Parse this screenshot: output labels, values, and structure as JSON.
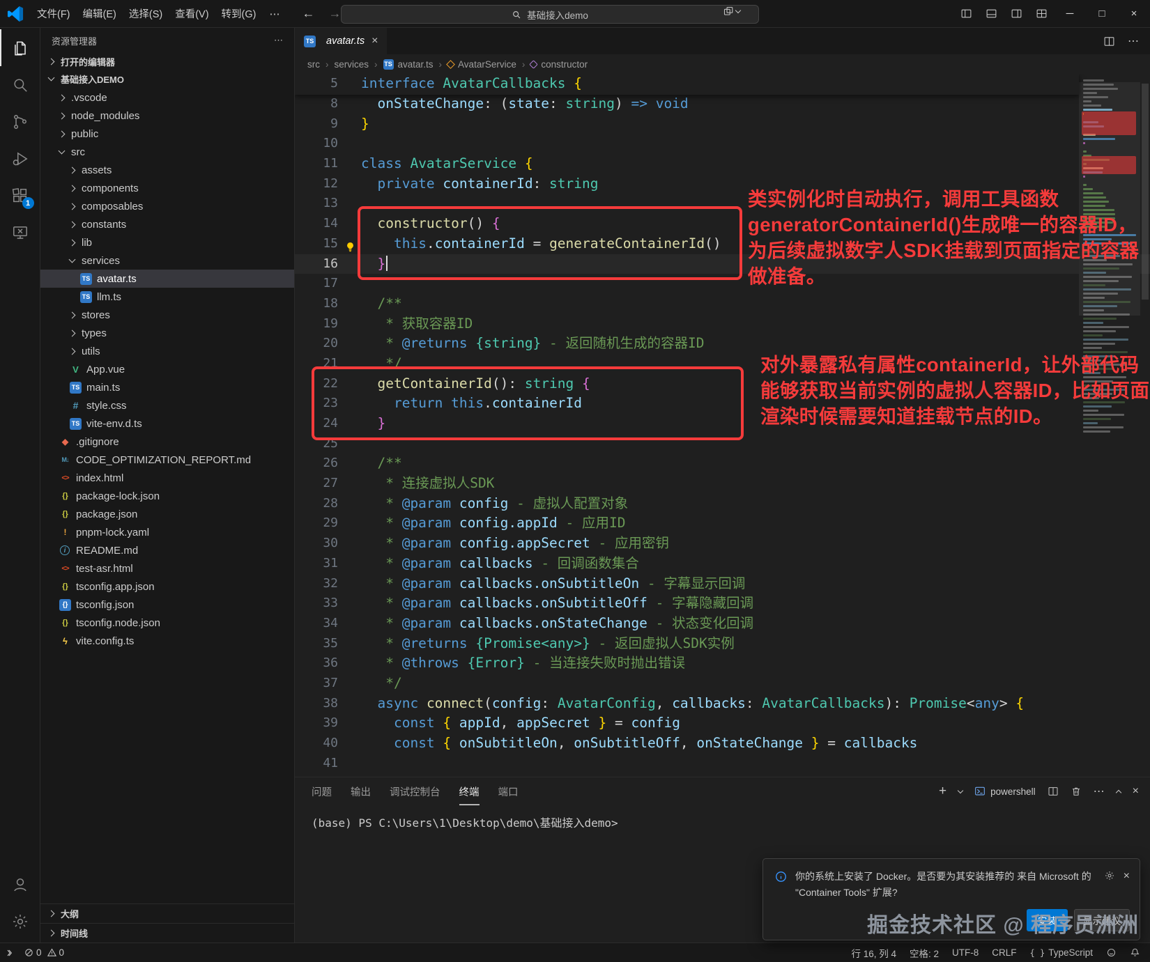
{
  "colors": {
    "accent": "#0078d4",
    "red": "#f53b3b",
    "kw": "#569cd6",
    "type": "#4ec9b0",
    "fn": "#dcdcaa",
    "var": "#9cdcfe",
    "cm": "#6a9955",
    "tag": "#569cd6",
    "doctype": "#4ec9b0",
    "pl": "#d4d4d4",
    "br": "#ffd700",
    "brp": "#da70d6"
  },
  "glyphs": {
    "back": "←",
    "forward": "→",
    "more": "⋯",
    "window_minimize": "─",
    "window_maximize": "□",
    "window_close": "×",
    "tab_close": "×",
    "panel_plus": "+",
    "panel_more": "⋯",
    "panel_close": "×",
    "toast_close": "×",
    "breadcrumb_sep": "›",
    "sidebar_more": "⋯",
    "tab_actions_more": "⋯"
  },
  "icon_glyphs": {
    "ts": "TS",
    "vue": "V",
    "css": "#",
    "git": "◆",
    "md": "M↓",
    "info": "i",
    "html": "<>",
    "json": "{}",
    "yaml": "!",
    "tsconfig": "{}",
    "vite": "ϟ"
  },
  "title_bar": {
    "menus": [
      "文件(F)",
      "编辑(E)",
      "选择(S)",
      "查看(V)",
      "转到(G)"
    ],
    "command_center": "基础接入demo"
  },
  "activity_bar": {
    "extensions_badge": "1"
  },
  "sidebar": {
    "header": "资源管理器",
    "open_editors": "打开的编辑器",
    "project": "基础接入DEMO",
    "outline": "大纲",
    "timeline": "时间线",
    "tree": [
      {
        "label": ".vscode",
        "lvl": 1,
        "folder": true
      },
      {
        "label": "node_modules",
        "lvl": 1,
        "folder": true
      },
      {
        "label": "public",
        "lvl": 1,
        "folder": true
      },
      {
        "label": "src",
        "lvl": 1,
        "folder": true,
        "expanded": true
      },
      {
        "label": "assets",
        "lvl": 2,
        "folder": true
      },
      {
        "label": "components",
        "lvl": 2,
        "folder": true
      },
      {
        "label": "composables",
        "lvl": 2,
        "folder": true
      },
      {
        "label": "constants",
        "lvl": 2,
        "folder": true
      },
      {
        "label": "lib",
        "lvl": 2,
        "folder": true
      },
      {
        "label": "services",
        "lvl": 2,
        "folder": true,
        "expanded": true
      },
      {
        "label": "avatar.ts",
        "lvl": 3,
        "icon": "ts",
        "selected": true
      },
      {
        "label": "llm.ts",
        "lvl": 3,
        "icon": "ts"
      },
      {
        "label": "stores",
        "lvl": 2,
        "folder": true
      },
      {
        "label": "types",
        "lvl": 2,
        "folder": true
      },
      {
        "label": "utils",
        "lvl": 2,
        "folder": true
      },
      {
        "label": "App.vue",
        "lvl": 2,
        "icon": "vue"
      },
      {
        "label": "main.ts",
        "lvl": 2,
        "icon": "ts"
      },
      {
        "label": "style.css",
        "lvl": 2,
        "icon": "css"
      },
      {
        "label": "vite-env.d.ts",
        "lvl": 2,
        "icon": "ts"
      },
      {
        "label": ".gitignore",
        "lvl": 1,
        "icon": "git"
      },
      {
        "label": "CODE_OPTIMIZATION_REPORT.md",
        "lvl": 1,
        "icon": "md"
      },
      {
        "label": "index.html",
        "lvl": 1,
        "icon": "html"
      },
      {
        "label": "package-lock.json",
        "lvl": 1,
        "icon": "json"
      },
      {
        "label": "package.json",
        "lvl": 1,
        "icon": "json"
      },
      {
        "label": "pnpm-lock.yaml",
        "lvl": 1,
        "icon": "yaml"
      },
      {
        "label": "README.md",
        "lvl": 1,
        "icon": "info"
      },
      {
        "label": "test-asr.html",
        "lvl": 1,
        "icon": "html"
      },
      {
        "label": "tsconfig.app.json",
        "lvl": 1,
        "icon": "json"
      },
      {
        "label": "tsconfig.json",
        "lvl": 1,
        "icon": "tsconfig"
      },
      {
        "label": "tsconfig.node.json",
        "lvl": 1,
        "icon": "json"
      },
      {
        "label": "vite.config.ts",
        "lvl": 1,
        "icon": "vite"
      }
    ]
  },
  "editor": {
    "tab": "avatar.ts",
    "breadcrumbs": [
      {
        "label": "src"
      },
      {
        "label": "services"
      },
      {
        "label": "avatar.ts",
        "icon": "ts"
      },
      {
        "label": "AvatarService",
        "icon": "class"
      },
      {
        "label": "constructor",
        "icon": "method"
      }
    ],
    "sticky_line": {
      "num": 5,
      "tokens": [
        [
          "kw",
          "interface"
        ],
        [
          "pl",
          " "
        ],
        [
          "type",
          "AvatarCallbacks"
        ],
        [
          "pl",
          " "
        ],
        [
          "br",
          "{"
        ]
      ]
    },
    "code_lines": [
      {
        "num": 8,
        "tokens": [
          [
            "pl",
            "  "
          ],
          [
            "var",
            "onStateChange"
          ],
          [
            "pl",
            ": ("
          ],
          [
            "var",
            "state"
          ],
          [
            "pl",
            ": "
          ],
          [
            "type",
            "string"
          ],
          [
            "pl",
            ") "
          ],
          [
            "kw",
            "=>"
          ],
          [
            "pl",
            " "
          ],
          [
            "kw",
            "void"
          ]
        ]
      },
      {
        "num": 9,
        "tokens": [
          [
            "br",
            "}"
          ]
        ]
      },
      {
        "num": 10,
        "tokens": []
      },
      {
        "num": 11,
        "tokens": [
          [
            "kw",
            "class"
          ],
          [
            "pl",
            " "
          ],
          [
            "type",
            "AvatarService"
          ],
          [
            "pl",
            " "
          ],
          [
            "br",
            "{"
          ]
        ]
      },
      {
        "num": 12,
        "tokens": [
          [
            "pl",
            "  "
          ],
          [
            "kw",
            "private"
          ],
          [
            "pl",
            " "
          ],
          [
            "var",
            "containerId"
          ],
          [
            "pl",
            ": "
          ],
          [
            "type",
            "string"
          ]
        ]
      },
      {
        "num": 13,
        "tokens": []
      },
      {
        "num": 14,
        "tokens": [
          [
            "pl",
            "  "
          ],
          [
            "fn",
            "constructor"
          ],
          [
            "pl",
            "() "
          ],
          [
            "brp",
            "{"
          ]
        ]
      },
      {
        "num": 15,
        "bulb": true,
        "tokens": [
          [
            "pl",
            "    "
          ],
          [
            "kw",
            "this"
          ],
          [
            "pl",
            "."
          ],
          [
            "var",
            "containerId"
          ],
          [
            "pl",
            " = "
          ],
          [
            "fn",
            "generateContainerId"
          ],
          [
            "pl",
            "()"
          ]
        ]
      },
      {
        "num": 16,
        "current": true,
        "caret": true,
        "tokens": [
          [
            "pl",
            "  "
          ],
          [
            "brp",
            "}"
          ]
        ]
      },
      {
        "num": 17,
        "tokens": []
      },
      {
        "num": 18,
        "tokens": [
          [
            "cm",
            "  /**"
          ]
        ]
      },
      {
        "num": 19,
        "tokens": [
          [
            "cm",
            "   * 获取容器ID"
          ]
        ]
      },
      {
        "num": 20,
        "tokens": [
          [
            "cm",
            "   * "
          ],
          [
            "tag",
            "@returns"
          ],
          [
            "cm",
            " "
          ],
          [
            "doctype",
            "{string}"
          ],
          [
            "cm",
            " - 返回随机生成的容器ID"
          ]
        ]
      },
      {
        "num": 21,
        "tokens": [
          [
            "cm",
            "   */"
          ]
        ]
      },
      {
        "num": 22,
        "tokens": [
          [
            "pl",
            "  "
          ],
          [
            "fn",
            "getContainerId"
          ],
          [
            "pl",
            "(): "
          ],
          [
            "type",
            "string"
          ],
          [
            "pl",
            " "
          ],
          [
            "brp",
            "{"
          ]
        ]
      },
      {
        "num": 23,
        "tokens": [
          [
            "pl",
            "    "
          ],
          [
            "kw",
            "return"
          ],
          [
            "pl",
            " "
          ],
          [
            "kw",
            "this"
          ],
          [
            "pl",
            "."
          ],
          [
            "var",
            "containerId"
          ]
        ]
      },
      {
        "num": 24,
        "tokens": [
          [
            "pl",
            "  "
          ],
          [
            "brp",
            "}"
          ]
        ]
      },
      {
        "num": 25,
        "tokens": []
      },
      {
        "num": 26,
        "tokens": [
          [
            "cm",
            "  /**"
          ]
        ]
      },
      {
        "num": 27,
        "tokens": [
          [
            "cm",
            "   * 连接虚拟人SDK"
          ]
        ]
      },
      {
        "num": 28,
        "tokens": [
          [
            "cm",
            "   * "
          ],
          [
            "tag",
            "@param"
          ],
          [
            "cm",
            " "
          ],
          [
            "var",
            "config"
          ],
          [
            "cm",
            " - 虚拟人配置对象"
          ]
        ]
      },
      {
        "num": 29,
        "tokens": [
          [
            "cm",
            "   * "
          ],
          [
            "tag",
            "@param"
          ],
          [
            "cm",
            " "
          ],
          [
            "var",
            "config.appId"
          ],
          [
            "cm",
            " - 应用ID"
          ]
        ]
      },
      {
        "num": 30,
        "tokens": [
          [
            "cm",
            "   * "
          ],
          [
            "tag",
            "@param"
          ],
          [
            "cm",
            " "
          ],
          [
            "var",
            "config.appSecret"
          ],
          [
            "cm",
            " - 应用密钥"
          ]
        ]
      },
      {
        "num": 31,
        "tokens": [
          [
            "cm",
            "   * "
          ],
          [
            "tag",
            "@param"
          ],
          [
            "cm",
            " "
          ],
          [
            "var",
            "callbacks"
          ],
          [
            "cm",
            " - 回调函数集合"
          ]
        ]
      },
      {
        "num": 32,
        "tokens": [
          [
            "cm",
            "   * "
          ],
          [
            "tag",
            "@param"
          ],
          [
            "cm",
            " "
          ],
          [
            "var",
            "callbacks.onSubtitleOn"
          ],
          [
            "cm",
            " - 字幕显示回调"
          ]
        ]
      },
      {
        "num": 33,
        "tokens": [
          [
            "cm",
            "   * "
          ],
          [
            "tag",
            "@param"
          ],
          [
            "cm",
            " "
          ],
          [
            "var",
            "callbacks.onSubtitleOff"
          ],
          [
            "cm",
            " - 字幕隐藏回调"
          ]
        ]
      },
      {
        "num": 34,
        "tokens": [
          [
            "cm",
            "   * "
          ],
          [
            "tag",
            "@param"
          ],
          [
            "cm",
            " "
          ],
          [
            "var",
            "callbacks.onStateChange"
          ],
          [
            "cm",
            " - 状态变化回调"
          ]
        ]
      },
      {
        "num": 35,
        "tokens": [
          [
            "cm",
            "   * "
          ],
          [
            "tag",
            "@returns"
          ],
          [
            "cm",
            " "
          ],
          [
            "doctype",
            "{Promise<any>}"
          ],
          [
            "cm",
            " - 返回虚拟人SDK实例"
          ]
        ]
      },
      {
        "num": 36,
        "tokens": [
          [
            "cm",
            "   * "
          ],
          [
            "tag",
            "@throws"
          ],
          [
            "cm",
            " "
          ],
          [
            "doctype",
            "{Error}"
          ],
          [
            "cm",
            " - 当连接失败时抛出错误"
          ]
        ]
      },
      {
        "num": 37,
        "tokens": [
          [
            "cm",
            "   */"
          ]
        ]
      },
      {
        "num": 38,
        "tokens": [
          [
            "pl",
            "  "
          ],
          [
            "kw",
            "async"
          ],
          [
            "pl",
            " "
          ],
          [
            "fn",
            "connect"
          ],
          [
            "pl",
            "("
          ],
          [
            "var",
            "config"
          ],
          [
            "pl",
            ": "
          ],
          [
            "type",
            "AvatarConfig"
          ],
          [
            "pl",
            ", "
          ],
          [
            "var",
            "callbacks"
          ],
          [
            "pl",
            ": "
          ],
          [
            "type",
            "AvatarCallbacks"
          ],
          [
            "pl",
            "): "
          ],
          [
            "type",
            "Promise"
          ],
          [
            "pl",
            "<"
          ],
          [
            "kw",
            "any"
          ],
          [
            "pl",
            "> "
          ],
          [
            "br",
            "{"
          ]
        ]
      },
      {
        "num": 39,
        "tokens": [
          [
            "pl",
            "    "
          ],
          [
            "kw",
            "const"
          ],
          [
            "pl",
            " "
          ],
          [
            "br",
            "{"
          ],
          [
            "pl",
            " "
          ],
          [
            "var",
            "appId"
          ],
          [
            "pl",
            ", "
          ],
          [
            "var",
            "appSecret"
          ],
          [
            "pl",
            " "
          ],
          [
            "br",
            "}"
          ],
          [
            "pl",
            " = "
          ],
          [
            "var",
            "config"
          ]
        ]
      },
      {
        "num": 40,
        "tokens": [
          [
            "pl",
            "    "
          ],
          [
            "kw",
            "const"
          ],
          [
            "pl",
            " "
          ],
          [
            "br",
            "{"
          ],
          [
            "pl",
            " "
          ],
          [
            "var",
            "onSubtitleOn"
          ],
          [
            "pl",
            ", "
          ],
          [
            "var",
            "onSubtitleOff"
          ],
          [
            "pl",
            ", "
          ],
          [
            "var",
            "onStateChange"
          ],
          [
            "pl",
            " "
          ],
          [
            "br",
            "}"
          ],
          [
            "pl",
            " = "
          ],
          [
            "var",
            "callbacks"
          ]
        ]
      },
      {
        "num": 41,
        "tokens": []
      }
    ],
    "annotations": {
      "note1": "类实例化时自动执行，调用工具函数generatorContainerId()生成唯一的容器ID，为后续虚拟数字人SDK挂载到页面指定的容器做准备。",
      "note2": "对外暴露私有属性containerId，让外部代码能够获取当前实例的虚拟人容器ID，比如页面渲染时候需要知道挂载节点的ID。"
    }
  },
  "panel": {
    "tabs": [
      "问题",
      "输出",
      "调试控制台",
      "终端",
      "端口"
    ],
    "active_tab": "终端",
    "shell_label": "powershell",
    "terminal_line": "(base) PS C:\\Users\\1\\Desktop\\demo\\基础接入demo>"
  },
  "notification": {
    "message": "你的系统上安装了 Docker。是否要为其安装推荐的 来自 Microsoft 的 \"Container Tools\" 扩展?",
    "install_label": "安装",
    "recommend_label": "显示建议"
  },
  "watermark": "掘金技术社区 @ 程序员洲洲",
  "status_bar": {
    "errors": "0",
    "warnings": "0",
    "line_col": "行 16, 列 4",
    "indent": "空格: 2",
    "encoding": "UTF-8",
    "eol": "CRLF",
    "language": "TypeScript",
    "language_icon": "{ }"
  }
}
